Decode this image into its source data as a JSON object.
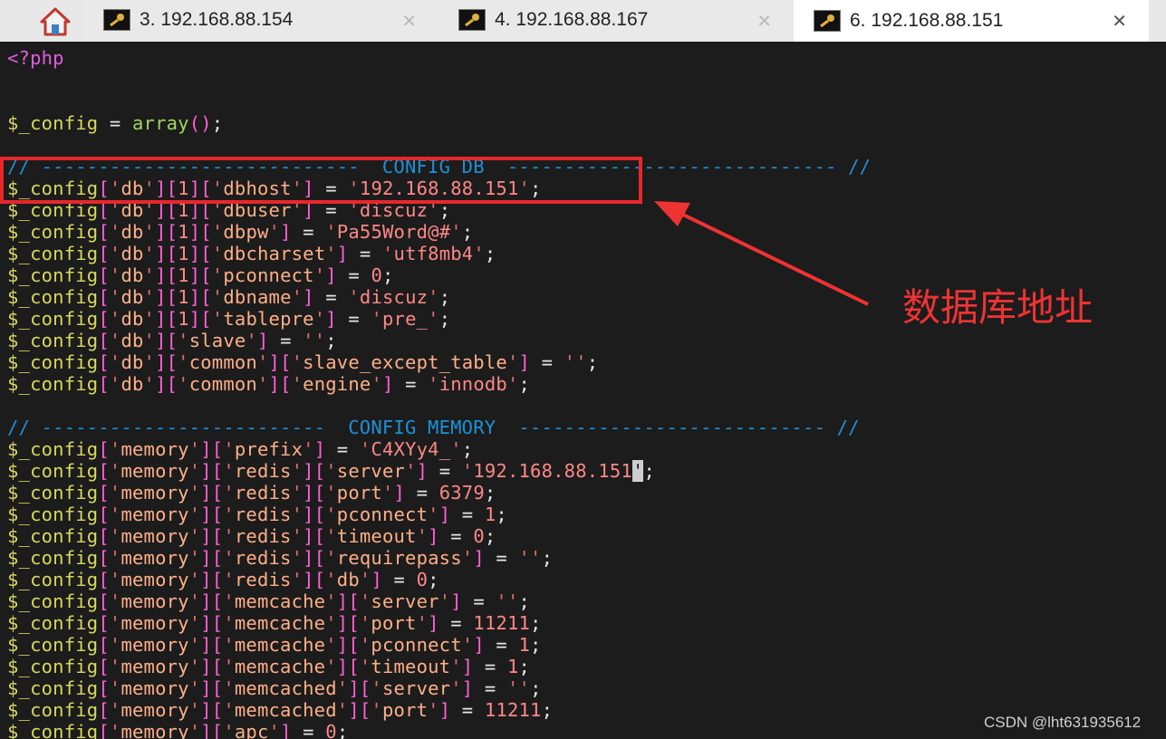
{
  "tabs": [
    {
      "label": "3. 192.168.88.154",
      "active": false
    },
    {
      "label": "4. 192.168.88.167",
      "active": false
    },
    {
      "label": "6. 192.168.88.151",
      "active": true
    }
  ],
  "icons": {
    "home": "home-icon",
    "key": "key-icon",
    "close": "close-icon"
  },
  "code": {
    "php_open": "<?php",
    "config_array": "$_config = array();",
    "db_header": "// ----------------------------  CONFIG DB  ----------------------------- //",
    "mem_header": "// -------------------------  CONFIG MEMORY  --------------------------- //",
    "db_lines": [
      {
        "keys": [
          "'db'",
          "[1]",
          "'dbhost'"
        ],
        "value": "'192.168.88.151'"
      },
      {
        "keys": [
          "'db'",
          "[1]",
          "'dbuser'"
        ],
        "value": "'discuz'"
      },
      {
        "keys": [
          "'db'",
          "[1]",
          "'dbpw'"
        ],
        "value": "'Pa55Word@#'"
      },
      {
        "keys": [
          "'db'",
          "[1]",
          "'dbcharset'"
        ],
        "value": "'utf8mb4'"
      },
      {
        "keys": [
          "'db'",
          "[1]",
          "'pconnect'"
        ],
        "value": "0"
      },
      {
        "keys": [
          "'db'",
          "[1]",
          "'dbname'"
        ],
        "value": "'discuz'"
      },
      {
        "keys": [
          "'db'",
          "[1]",
          "'tablepre'"
        ],
        "value": "'pre_'"
      },
      {
        "keys": [
          "'db'",
          "'slave'"
        ],
        "value": "''"
      },
      {
        "keys": [
          "'db'",
          "'common'",
          "'slave_except_table'"
        ],
        "value": "''"
      },
      {
        "keys": [
          "'db'",
          "'common'",
          "'engine'"
        ],
        "value": "'innodb'"
      }
    ],
    "mem_lines": [
      {
        "keys": [
          "'memory'",
          "'prefix'"
        ],
        "value": "'C4XYy4_'"
      },
      {
        "keys": [
          "'memory'",
          "'redis'",
          "'server'"
        ],
        "value": "'192.168.88.151'"
      },
      {
        "keys": [
          "'memory'",
          "'redis'",
          "'port'"
        ],
        "value": "6379"
      },
      {
        "keys": [
          "'memory'",
          "'redis'",
          "'pconnect'"
        ],
        "value": "1"
      },
      {
        "keys": [
          "'memory'",
          "'redis'",
          "'timeout'"
        ],
        "value": "0"
      },
      {
        "keys": [
          "'memory'",
          "'redis'",
          "'requirepass'"
        ],
        "value": "''"
      },
      {
        "keys": [
          "'memory'",
          "'redis'",
          "'db'"
        ],
        "value": "0"
      },
      {
        "keys": [
          "'memory'",
          "'memcache'",
          "'server'"
        ],
        "value": "''"
      },
      {
        "keys": [
          "'memory'",
          "'memcache'",
          "'port'"
        ],
        "value": "11211"
      },
      {
        "keys": [
          "'memory'",
          "'memcache'",
          "'pconnect'"
        ],
        "value": "1"
      },
      {
        "keys": [
          "'memory'",
          "'memcache'",
          "'timeout'"
        ],
        "value": "1"
      },
      {
        "keys": [
          "'memory'",
          "'memcached'",
          "'server'"
        ],
        "value": "''"
      },
      {
        "keys": [
          "'memory'",
          "'memcached'",
          "'port'"
        ],
        "value": "11211"
      },
      {
        "keys": [
          "'memory'",
          "'apc'"
        ],
        "value": "0"
      }
    ]
  },
  "annotation": {
    "label": "数据库地址",
    "color": "#ee3333"
  },
  "watermark": "CSDN @lht631935612"
}
